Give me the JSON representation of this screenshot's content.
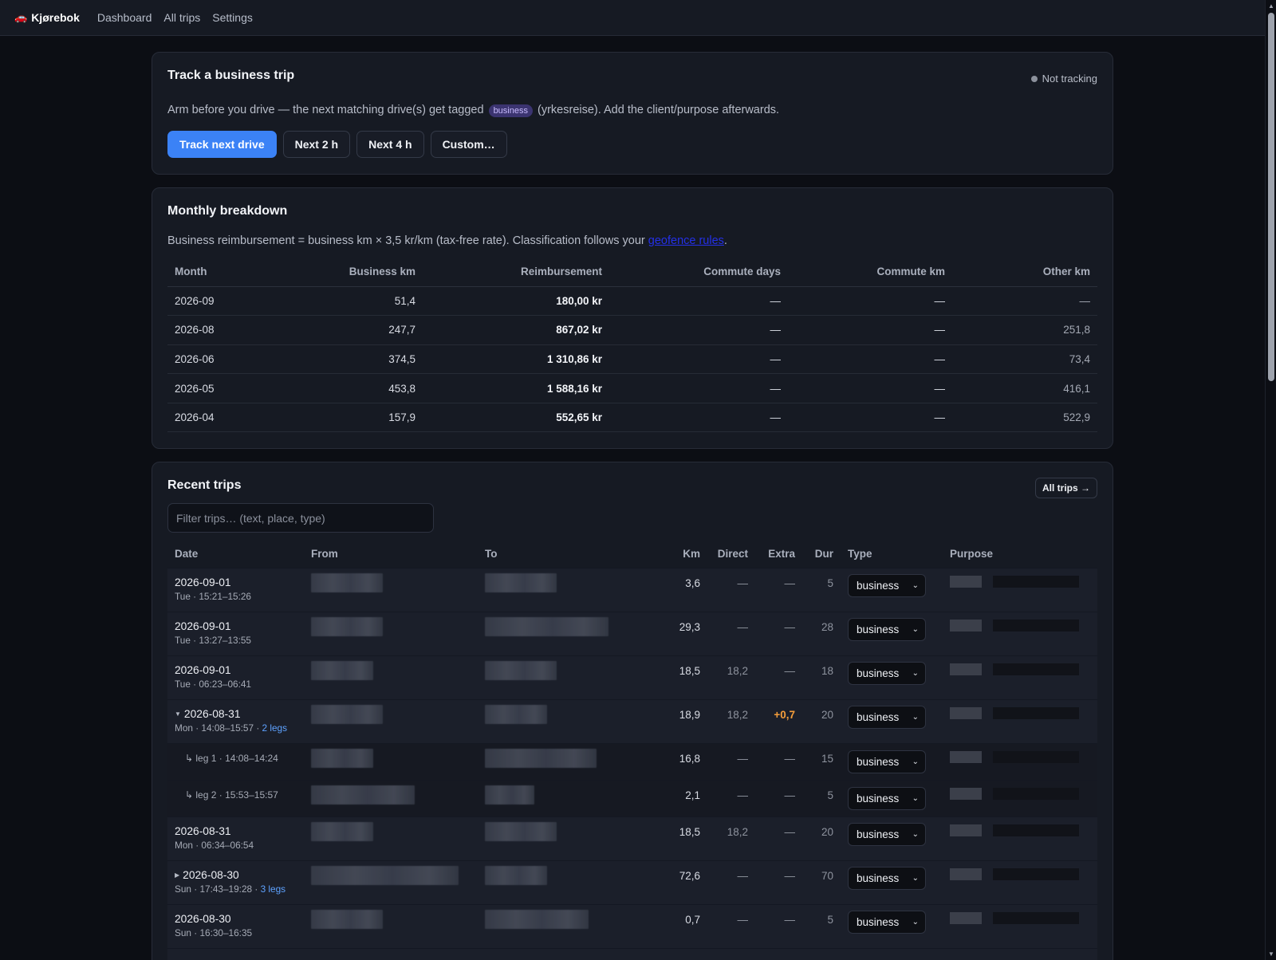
{
  "nav": {
    "brand": "Kjørebok",
    "links": [
      "Dashboard",
      "All trips",
      "Settings"
    ]
  },
  "track": {
    "title": "Track a business trip",
    "status": "Not tracking",
    "desc_before": "Arm before you drive — the next matching drive(s) get tagged",
    "tag": "business",
    "desc_after": "(yrkesreise). Add the client/purpose afterwards.",
    "buttons": [
      "Track next drive",
      "Next 2 h",
      "Next 4 h",
      "Custom…"
    ]
  },
  "monthly": {
    "title": "Monthly breakdown",
    "desc_before": "Business reimbursement = business km × 3,5 kr/km (tax-free rate). Classification follows your",
    "desc_link": "geofence rules",
    "desc_after": ".",
    "columns": [
      "Month",
      "Business km",
      "Reimbursement",
      "Commute days",
      "Commute km",
      "Other km"
    ],
    "rows": [
      {
        "month": "2026-09",
        "business_km": "51,4",
        "reimbursement": "180,00 kr",
        "commute_days": "—",
        "commute_km": "—",
        "other_km": "—"
      },
      {
        "month": "2026-08",
        "business_km": "247,7",
        "reimbursement": "867,02 kr",
        "commute_days": "—",
        "commute_km": "—",
        "other_km": "251,8"
      },
      {
        "month": "2026-06",
        "business_km": "374,5",
        "reimbursement": "1 310,86 kr",
        "commute_days": "—",
        "commute_km": "—",
        "other_km": "73,4"
      },
      {
        "month": "2026-05",
        "business_km": "453,8",
        "reimbursement": "1 588,16 kr",
        "commute_days": "—",
        "commute_km": "—",
        "other_km": "416,1"
      },
      {
        "month": "2026-04",
        "business_km": "157,9",
        "reimbursement": "552,65 kr",
        "commute_days": "—",
        "commute_km": "—",
        "other_km": "522,9"
      }
    ]
  },
  "recent": {
    "title": "Recent trips",
    "all_trips_btn": "All trips →",
    "filter_placeholder": "Filter trips… (text, place, type)",
    "columns": [
      "Date",
      "From",
      "To",
      "Km",
      "Direct",
      "Extra",
      "Dur",
      "Type",
      "Purpose"
    ],
    "rows": [
      {
        "kind": "trip",
        "date": "2026-09-01",
        "sub": "Tue · 15:21–15:26",
        "legs": "",
        "caret": "",
        "km": "3,6",
        "direct": "—",
        "extra": "—",
        "dur": "5",
        "type": "business",
        "from_w": 90,
        "to_w": 90
      },
      {
        "kind": "trip",
        "date": "2026-09-01",
        "sub": "Tue · 13:27–13:55",
        "legs": "",
        "caret": "",
        "km": "29,3",
        "direct": "—",
        "extra": "—",
        "dur": "28",
        "type": "business",
        "from_w": 90,
        "to_w": 155
      },
      {
        "kind": "trip",
        "date": "2026-09-01",
        "sub": "Tue · 06:23–06:41",
        "legs": "",
        "caret": "",
        "km": "18,5",
        "direct": "18,2",
        "extra": "—",
        "dur": "18",
        "type": "business",
        "from_w": 78,
        "to_w": 90
      },
      {
        "kind": "trip",
        "date": "2026-08-31",
        "sub": "Mon · 14:08–15:57 · ",
        "legs": "2 legs",
        "caret": "▼",
        "km": "18,9",
        "direct": "18,2",
        "extra": "+0,7",
        "dur": "20",
        "type": "business",
        "from_w": 90,
        "to_w": 78
      },
      {
        "kind": "leg",
        "label": "↳ leg 1 · 14:08–14:24",
        "km": "16,8",
        "direct": "—",
        "extra": "—",
        "dur": "15",
        "type": "business",
        "from_w": 78,
        "to_w": 140
      },
      {
        "kind": "leg",
        "label": "↳ leg 2 · 15:53–15:57",
        "km": "2,1",
        "direct": "—",
        "extra": "—",
        "dur": "5",
        "type": "business",
        "from_w": 130,
        "to_w": 62
      },
      {
        "kind": "trip",
        "date": "2026-08-31",
        "sub": "Mon · 06:34–06:54",
        "legs": "",
        "caret": "",
        "km": "18,5",
        "direct": "18,2",
        "extra": "—",
        "dur": "20",
        "type": "business",
        "from_w": 78,
        "to_w": 90
      },
      {
        "kind": "trip",
        "date": "2026-08-30",
        "sub": "Sun · 17:43–19:28 · ",
        "legs": "3 legs",
        "caret": "▶",
        "km": "72,6",
        "direct": "—",
        "extra": "—",
        "dur": "70",
        "type": "business",
        "from_w": 185,
        "to_w": 78
      },
      {
        "kind": "trip",
        "date": "2026-08-30",
        "sub": "Sun · 16:30–16:35",
        "legs": "",
        "caret": "",
        "km": "0,7",
        "direct": "—",
        "extra": "—",
        "dur": "5",
        "type": "business",
        "from_w": 90,
        "to_w": 130
      },
      {
        "kind": "trip",
        "date": "",
        "sub": "",
        "legs": "",
        "caret": "",
        "km": "",
        "direct": "",
        "extra": "",
        "dur": "",
        "type": "",
        "from_w": 0,
        "to_w": 0
      }
    ]
  }
}
